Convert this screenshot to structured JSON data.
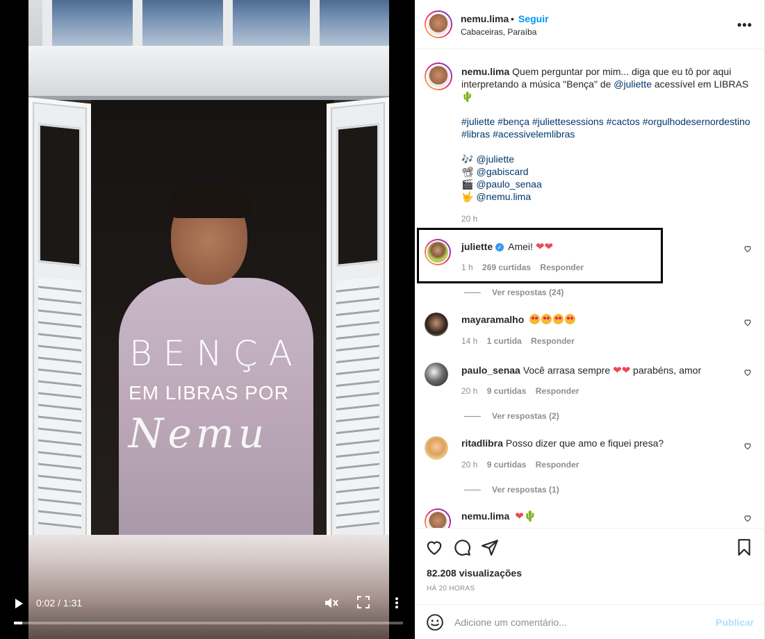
{
  "video": {
    "overlay_line1": "BENÇA",
    "overlay_line2": "EM LIBRAS POR",
    "overlay_signature": "Nemu",
    "time": "0:02 / 1:31",
    "progress": 0.022
  },
  "header": {
    "username": "nemu.lima",
    "separator": "•",
    "follow_label": "Seguir",
    "location": "Cabaceiras, Paraíba",
    "more_label": "•••"
  },
  "caption": {
    "username": "nemu.lima",
    "text_before": "Quem perguntar por mim... diga que eu tô por aqui interpretando a música \"Bença\" de",
    "mention": "@juliette",
    "text_after": "acessível em LIBRAS",
    "emoji": "🌵",
    "hashtags": [
      "#juliette",
      "#bença",
      "#juliettesessions",
      "#cactos",
      "#orgulhodesernordestino",
      "#libras",
      "#acessivelemlibras"
    ],
    "credits": [
      {
        "icon": "🎶",
        "mention": "@juliette"
      },
      {
        "icon": "📽",
        "mention": "@gabiscard"
      },
      {
        "icon": "🎬",
        "mention": "@paulo_senaa"
      },
      {
        "icon": "🤟",
        "mention": "@nemu.lima"
      }
    ],
    "time": "20 h"
  },
  "comments": [
    {
      "username": "juliette",
      "verified": true,
      "text": "Amei!",
      "emojis": "❤❤",
      "time": "1 h",
      "likes": "269 curtidas",
      "reply": "Responder",
      "view_replies": "Ver respostas (24)"
    },
    {
      "username": "mayaramalho",
      "verified": false,
      "text": "",
      "emojis": "😍😍😍😍",
      "time": "14 h",
      "likes": "1 curtida",
      "reply": "Responder",
      "view_replies": ""
    },
    {
      "username": "paulo_senaa",
      "verified": false,
      "text": "Você arrasa sempre",
      "emojis": "❤❤",
      "text_after": "parabéns, amor",
      "time": "20 h",
      "likes": "9 curtidas",
      "reply": "Responder",
      "view_replies": "Ver respostas (2)"
    },
    {
      "username": "ritadlibra",
      "verified": false,
      "text": "Posso dizer que amo e fiquei presa?",
      "emojis": "",
      "time": "20 h",
      "likes": "9 curtidas",
      "reply": "Responder",
      "view_replies": "Ver respostas (1)"
    },
    {
      "username": "nemu.lima",
      "verified": false,
      "text": "",
      "emojis": "❤🌵",
      "time": "",
      "likes": "",
      "reply": "",
      "view_replies": ""
    }
  ],
  "actions": {
    "views": "82.208 visualizações",
    "ago": "HÁ 20 HORAS"
  },
  "add_comment": {
    "placeholder": "Adicione um comentário...",
    "publish_label": "Publicar"
  }
}
